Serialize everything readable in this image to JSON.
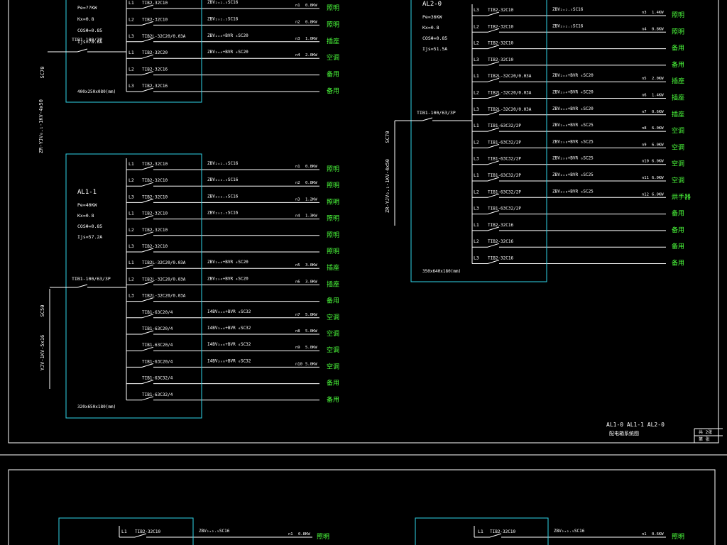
{
  "colors": {
    "background": "#000000",
    "frame": "#ffffff",
    "panel": "#2fd6ea",
    "wire": "#ffffff",
    "text": "#ffffff",
    "load": "#4cff3c"
  },
  "panels": [
    {
      "id": "al1-0",
      "name": "",
      "params": [
        "Pe=??KW",
        "Kx=0.8",
        "COSΦ=0.85",
        "Ijs=78.6A"
      ],
      "incomer": "TIB1-100/3P",
      "dims": "400x250x080(mm)",
      "cable": "ZR-YJV₀.₁-1KV-4x50",
      "conduit": "SC70",
      "circuits": [
        {
          "phase": "L1",
          "breaker": "TIB2-32C10",
          "cable": "ZBV₂ₓ₂.₅SC16",
          "no": "n1",
          "kw": "0.8KW",
          "load": "照明"
        },
        {
          "phase": "L2",
          "breaker": "TIB2-32C10",
          "cable": "ZBV₂ₓ₂.₅SC16",
          "no": "n2",
          "kw": "0.8KW",
          "load": "照明"
        },
        {
          "phase": "L3",
          "breaker": "TIB2L-32C20/0.03A",
          "cable": "ZBV₂ₓ₄+BVR ₄SC20",
          "no": "n3",
          "kw": "1.0KW",
          "load": "插座"
        },
        {
          "phase": "L1",
          "breaker": "TIB2-32C20",
          "cable": "ZBV₂ₓ₄+BVR ₄SC20",
          "no": "n4",
          "kw": "2.0KW",
          "load": "空调"
        },
        {
          "phase": "L2",
          "breaker": "TIB2-32C16",
          "cable": "",
          "no": "",
          "kw": "",
          "load": "备用"
        },
        {
          "phase": "L3",
          "breaker": "TIB2-32C16",
          "cable": "",
          "no": "",
          "kw": "",
          "load": "备用"
        }
      ]
    },
    {
      "id": "al1-1",
      "name": "AL1-1",
      "params": [
        "Pe=40KW",
        "Kx=0.8",
        "COSΦ=0.85",
        "Ijs=57.2A"
      ],
      "incomer": "TIB1-100/63/3P",
      "dims": "320x650x180(mm)",
      "cable": "YJV-1KV-5x16",
      "conduit": "SC50",
      "circuits": [
        {
          "phase": "L1",
          "breaker": "TIB2-32C10",
          "cable": "ZBV₂ₓ₂.₅SC16",
          "no": "n1",
          "kw": "0.8KW",
          "load": "照明"
        },
        {
          "phase": "L2",
          "breaker": "TIB2-32C10",
          "cable": "ZBV₂ₓ₂.₅SC16",
          "no": "n2",
          "kw": "0.8KW",
          "load": "照明"
        },
        {
          "phase": "L3",
          "breaker": "TIB2-32C10",
          "cable": "ZBV₂ₓ₂.₅SC16",
          "no": "n3",
          "kw": "1.2KW",
          "load": "照明"
        },
        {
          "phase": "L1",
          "breaker": "TIB2-32C10",
          "cable": "ZBV₂ₓ₂.₅SC16",
          "no": "n4",
          "kw": "1.3KW",
          "load": "照明"
        },
        {
          "phase": "L2",
          "breaker": "TIB2-32C10",
          "cable": "",
          "no": "",
          "kw": "",
          "load": "照明"
        },
        {
          "phase": "L3",
          "breaker": "TIB2-32C10",
          "cable": "",
          "no": "",
          "kw": "",
          "load": "照明"
        },
        {
          "phase": "L1",
          "breaker": "TIB2L-32C20/0.03A",
          "cable": "ZBV₂ₓ₄+BVR ₄SC20",
          "no": "n5",
          "kw": "3.0KW",
          "load": "插座"
        },
        {
          "phase": "L2",
          "breaker": "TIB2L-32C20/0.03A",
          "cable": "ZBV₂ₓ₄+BVR ₄SC20",
          "no": "n6",
          "kw": "3.0KW",
          "load": "插座"
        },
        {
          "phase": "L3",
          "breaker": "TIB2L-32C20/0.03A",
          "cable": "",
          "no": "",
          "kw": "",
          "load": "备用"
        },
        {
          "phase": "",
          "breaker": "TIB1-63C20/4",
          "cable": "I4BV₃ₓ₆+BVR ₆SC32",
          "no": "n7",
          "kw": "5.0KW",
          "load": "空调"
        },
        {
          "phase": "",
          "breaker": "TIB1-63C20/4",
          "cable": "I4BV₃ₓ₆+BVR ₆SC32",
          "no": "n8",
          "kw": "5.0KW",
          "load": "空调"
        },
        {
          "phase": "",
          "breaker": "TIB1-63C20/4",
          "cable": "I4BV₃ₓ₆+BVR ₆SC32",
          "no": "n9",
          "kw": "5.0KW",
          "load": "空调"
        },
        {
          "phase": "",
          "breaker": "TIB1-63C20/4",
          "cable": "I4BV₃ₓ₆+BVR ₆SC32",
          "no": "n10",
          "kw": "5.0KW",
          "load": "空调"
        },
        {
          "phase": "",
          "breaker": "TIB1-63C32/4",
          "cable": "",
          "no": "",
          "kw": "",
          "load": "备用"
        },
        {
          "phase": "",
          "breaker": "TIB1-63C32/4",
          "cable": "",
          "no": "",
          "kw": "",
          "load": "备用"
        }
      ]
    },
    {
      "id": "al2-0",
      "name": "AL2-0",
      "params": [
        "Pe=36KW",
        "Kx=0.8",
        "COSΦ=0.85",
        "Ijs=51.5A"
      ],
      "incomer": "TIB1-100/63/3P",
      "dims": "350x640x180(mm)",
      "cable": "ZR-YJV₀.₁-1KV-4x50",
      "conduit": "SC70",
      "circuits": [
        {
          "phase": "L3",
          "breaker": "TIB2-32C10",
          "cable": "ZBV₂ₓ₂.₅SC16",
          "no": "n3",
          "kw": "1.4KW",
          "load": "照明"
        },
        {
          "phase": "L2",
          "breaker": "TIB2-32C10",
          "cable": "ZBV₂ₓ₂.₅SC16",
          "no": "n4",
          "kw": "0.8KW",
          "load": "照明"
        },
        {
          "phase": "L2",
          "breaker": "TIB2-32C10",
          "cable": "",
          "no": "",
          "kw": "",
          "load": "备用"
        },
        {
          "phase": "L3",
          "breaker": "TIB2-32C10",
          "cable": "",
          "no": "",
          "kw": "",
          "load": "备用"
        },
        {
          "phase": "L1",
          "breaker": "TIB2L-32C20/0.03A",
          "cable": "ZBV₂ₓ₄+BVR ₄SC20",
          "no": "n5",
          "kw": "2.0KW",
          "load": "插座"
        },
        {
          "phase": "L2",
          "breaker": "TIB2L-32C20/0.03A",
          "cable": "ZBV₂ₓ₄+BVR ₄SC20",
          "no": "n6",
          "kw": "1.4KW",
          "load": "插座"
        },
        {
          "phase": "L3",
          "breaker": "TIB2L-32C20/0.03A",
          "cable": "ZBV₂ₓ₄+BVR ₄SC20",
          "no": "n7",
          "kw": "0.6KW",
          "load": "插座"
        },
        {
          "phase": "L1",
          "breaker": "TIB1-63C32/2P",
          "cable": "ZBV₂ₓ₆+BVR ₆SC25",
          "no": "n8",
          "kw": "6.0KW",
          "load": "空调"
        },
        {
          "phase": "L2",
          "breaker": "TIB1-63C32/2P",
          "cable": "ZBV₂ₓ₆+BVR ₆SC25",
          "no": "n9",
          "kw": "6.0KW",
          "load": "空调"
        },
        {
          "phase": "L3",
          "breaker": "TIB1-63C32/2P",
          "cable": "ZBV₂ₓ₆+BVR ₆SC25",
          "no": "n10",
          "kw": "6.0KW",
          "load": "空调"
        },
        {
          "phase": "L1",
          "breaker": "TIB1-63C32/2P",
          "cable": "ZBV₂ₓ₆+BVR ₆SC25",
          "no": "n11",
          "kw": "6.0KW",
          "load": "空调"
        },
        {
          "phase": "L2",
          "breaker": "TIB1-63C32/2P",
          "cable": "ZBV₂ₓ₆+BVR ₆SC25",
          "no": "n12",
          "kw": "6.0KW",
          "load": "烘手器"
        },
        {
          "phase": "L3",
          "breaker": "TIB1-63C32/2P",
          "cable": "",
          "no": "",
          "kw": "",
          "load": "备用"
        },
        {
          "phase": "L1",
          "breaker": "TIB2-32C16",
          "cable": "",
          "no": "",
          "kw": "",
          "load": "备用"
        },
        {
          "phase": "L2",
          "breaker": "TIB2-32C16",
          "cable": "",
          "no": "",
          "kw": "",
          "load": "备用"
        },
        {
          "phase": "L3",
          "breaker": "TIB2-32C16",
          "cable": "",
          "no": "",
          "kw": "",
          "load": "备用"
        }
      ]
    },
    {
      "id": "bottom-left",
      "name": "",
      "params": [],
      "incomer": "",
      "dims": "",
      "cable": "",
      "conduit": "",
      "circuits": [
        {
          "phase": "L1",
          "breaker": "TIB2-32C10",
          "cable": "ZBV₂ₓ₂.₅SC16",
          "no": "n1",
          "kw": "0.8KW",
          "load": "照明"
        }
      ]
    },
    {
      "id": "bottom-right",
      "name": "",
      "params": [],
      "incomer": "",
      "dims": "",
      "cable": "",
      "conduit": "",
      "circuits": [
        {
          "phase": "L1",
          "breaker": "TIB2-32C10",
          "cable": "ZBV₂ₓ₂.₅SC16",
          "no": "n1",
          "kw": "0.6KW",
          "load": "照明"
        }
      ]
    }
  ],
  "title_block": {
    "drawing_refs": "AL1-0  AL1-1  AL2-0",
    "drawing_name": "配电箱系统图",
    "sheet_total": "共  2张",
    "sheet_no": "第    张"
  }
}
